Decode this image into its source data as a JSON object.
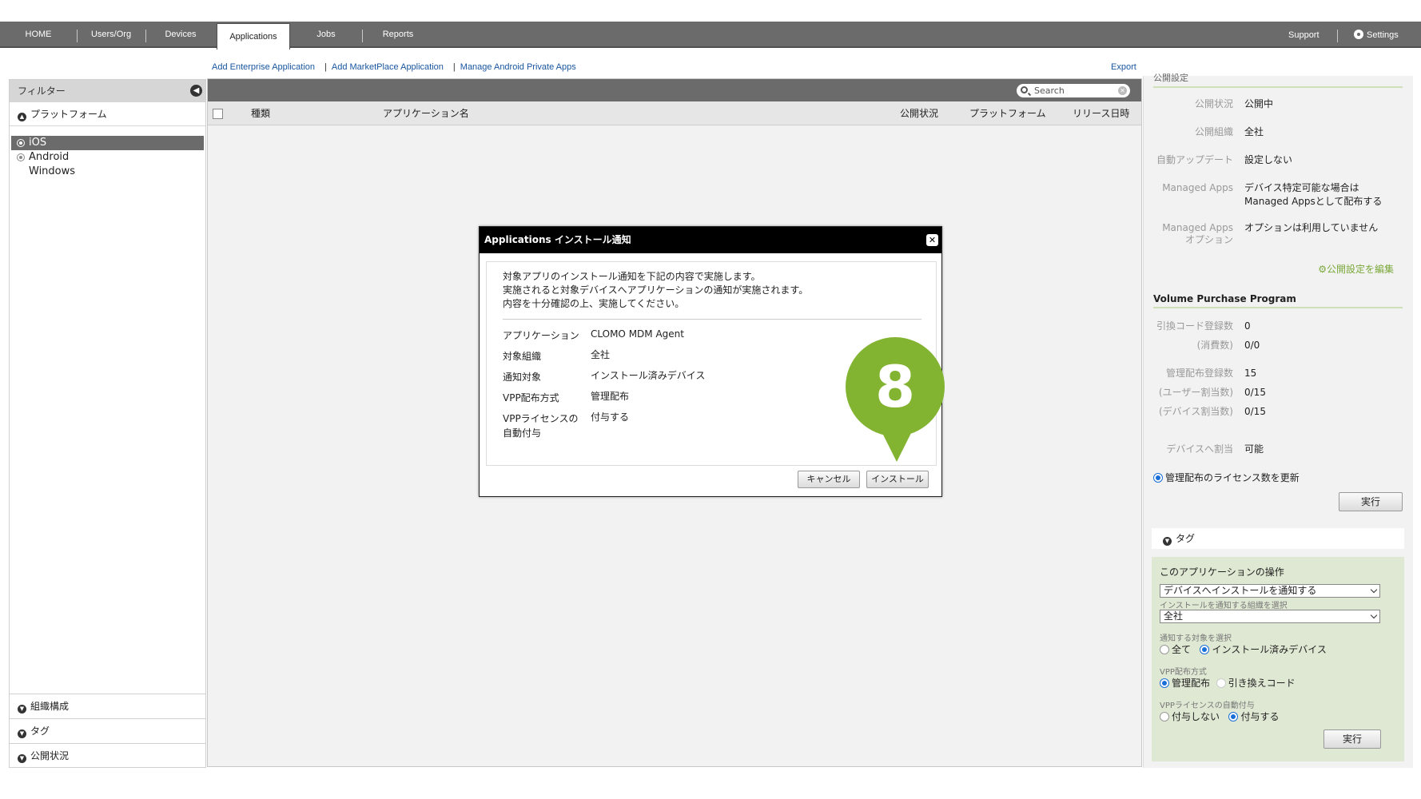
{
  "nav": {
    "tabs": [
      "HOME",
      "Users/Org",
      "Devices",
      "Applications",
      "Jobs",
      "Reports"
    ],
    "active_tab": "Applications",
    "support": "Support",
    "settings": "Settings"
  },
  "sublinks": {
    "add_enterprise": "Add Enterprise Application",
    "add_marketplace": "Add MarketPlace Application",
    "manage_android": "Manage Android Private Apps",
    "export": "Export"
  },
  "filter": {
    "title": "フィルター",
    "platform_head": "プラットフォーム",
    "platforms": [
      "iOS",
      "Android",
      "Windows"
    ],
    "selected_platform": "iOS",
    "sections": [
      "組織構成",
      "タグ",
      "公開状況"
    ]
  },
  "table": {
    "search_placeholder": "Search",
    "columns": [
      "種類",
      "アプリケーション名",
      "公開状況",
      "プラットフォーム",
      "リリース日時"
    ]
  },
  "right_panel": {
    "publish_title": "公開設定",
    "publish_rows": [
      {
        "label": "公開状況",
        "value": "公開中"
      },
      {
        "label": "公開組織",
        "value": "全社"
      },
      {
        "label": "自動アップデート",
        "value": "設定しない"
      },
      {
        "label": "Managed Apps",
        "value": "デバイス特定可能な場合は\nManaged Appsとして配布する"
      },
      {
        "label": "Managed Apps\nオプション",
        "value": "オプションは利用していません"
      }
    ],
    "edit_link": "公開設定を編集",
    "vpp_title": "Volume Purchase Program",
    "vpp_rows": [
      {
        "label": "引換コード登録数",
        "value": "0"
      },
      {
        "label": "(消費数)",
        "value": "0/0"
      },
      {
        "label": "管理配布登録数",
        "value": "15"
      },
      {
        "label": "(ユーザー割当数)",
        "value": "0/15"
      },
      {
        "label": "(デバイス割当数)",
        "value": "0/15"
      },
      {
        "label": "デバイスへ割当",
        "value": "可能"
      }
    ],
    "update_license": "管理配布のライセンス数を更新",
    "exec_label": "実行",
    "tag_label": "タグ",
    "ops": {
      "title": "このアプリケーションの操作",
      "action_select": "デバイスへインストールを通知する",
      "org_label": "インストールを通知する組織を選択",
      "org_select": "全社",
      "target_label": "通知する対象を選択",
      "target_all": "全て",
      "target_installed": "インストール済みデバイス",
      "vpp_method_label": "VPP配布方式",
      "vpp_managed": "管理配布",
      "vpp_code": "引き換えコード",
      "auto_license_label": "VPPライセンスの自動付与",
      "license_no": "付与しない",
      "license_yes": "付与する",
      "exec_label": "実行"
    }
  },
  "modal": {
    "title": "Applications インストール通知",
    "intro_1": "対象アプリのインストール通知を下記の内容で実施します。",
    "intro_2": "実施されると対象デバイスへアプリケーションの通知が実施されます。",
    "intro_3": "内容を十分確認の上、実施してください。",
    "rows": [
      {
        "label": "アプリケーション",
        "value": "CLOMO MDM Agent"
      },
      {
        "label": "対象組織",
        "value": "全社"
      },
      {
        "label": "通知対象",
        "value": "インストール済みデバイス"
      },
      {
        "label": "VPP配布方式",
        "value": "管理配布"
      },
      {
        "label": "VPPライセンスの\n自動付与",
        "value": "付与する"
      }
    ],
    "cancel": "キャンセル",
    "install": "インストール"
  },
  "step_marker": "8",
  "colors": {
    "nav_bg": "#6b6b6b",
    "accent_green": "#83b431",
    "link_blue": "#1a56a0"
  }
}
